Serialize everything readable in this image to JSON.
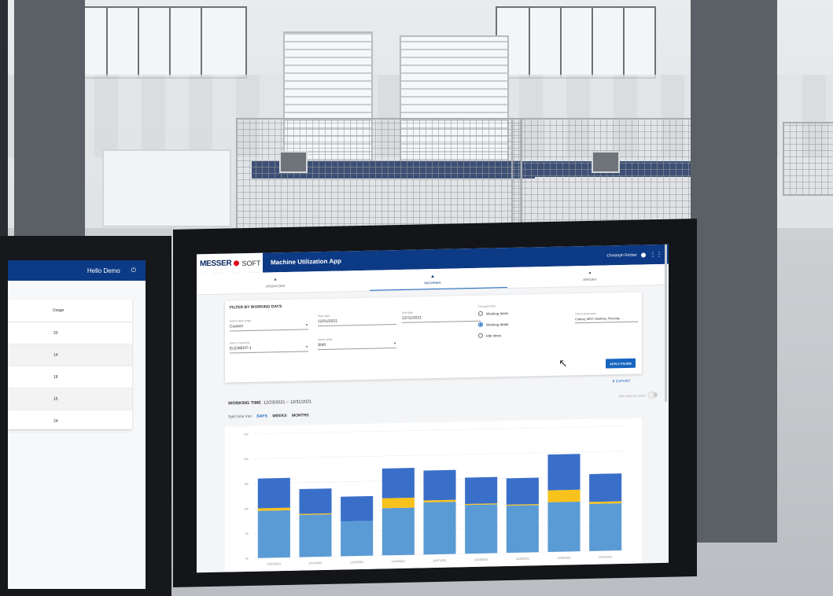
{
  "left_app": {
    "greeting": "Hello Demo",
    "power_icon": "power-icon",
    "table": {
      "header": "Usage",
      "values": [
        "20",
        "14",
        "18",
        "15",
        "24"
      ]
    }
  },
  "app": {
    "logo": {
      "brand": "MESSER",
      "suffix": "SOFT"
    },
    "title": "Machine Utilization App",
    "user": "Christoph Richter",
    "tabs": [
      {
        "label": "OPERATORS",
        "icon": "person-icon"
      },
      {
        "label": "MACHINES",
        "icon": "machine-icon",
        "active": true
      },
      {
        "label": "ERRORS",
        "icon": "error-icon"
      }
    ]
  },
  "filter": {
    "title": "FILTER BY WORKING DAYS",
    "date_range": {
      "label": "Select date range",
      "value": "Custom"
    },
    "start_date": {
      "label": "Start date",
      "value": "12/01/2021"
    },
    "end_date": {
      "label": "End date",
      "value": "12/31/2021"
    },
    "machines": {
      "label": "Select machines",
      "value": "ELEMENT-1"
    },
    "shifts": {
      "label": "Select shifts",
      "value": "Shift"
    },
    "processes": {
      "label": "Select processes",
      "value": "Cutting, MNT, Marking, Piercing..."
    },
    "occupied": {
      "label": "Occupied time",
      "options": [
        {
          "label": "Working times",
          "checked": false
        },
        {
          "label": "Working detail",
          "checked": true
        },
        {
          "label": "Idle times",
          "checked": false
        }
      ]
    },
    "apply_label": "APPLY FILTER"
  },
  "export_label": "EXPORT",
  "working_time": {
    "title": "WORKING TIME",
    "range": "12/23/2021 ~ 12/31/2021",
    "split_label": "Split time into",
    "options": [
      "DAYS",
      "WEEKS",
      "MONTHS"
    ],
    "split_shifts_label": "Split data into shifts"
  },
  "chart_data": {
    "type": "bar",
    "stacked": true,
    "colors": {
      "base": "#5b9bd5",
      "yellow": "#f8c21c",
      "top": "#3a6fc9"
    },
    "categories": [
      "12/23/2021",
      "12/24/2021",
      "12/25/2021",
      "12/26/2021",
      "12/27/2021",
      "12/28/2021",
      "12/29/2021",
      "12/30/2021",
      "12/31/2021"
    ],
    "series": [
      {
        "values": [
          9.5,
          8.5,
          7,
          9.5,
          10.5,
          9.8,
          9.5,
          10,
          9.5
        ]
      },
      {
        "values": [
          0.5,
          0.2,
          0,
          2,
          0.4,
          0.2,
          0.2,
          2.4,
          0.4
        ]
      },
      {
        "values": [
          6,
          5,
          5,
          6,
          6,
          5.3,
          5.3,
          7.2,
          5.6
        ]
      }
    ],
    "y_ticks": [
      "0h",
      "5h",
      "10h",
      "15h",
      "20h",
      "25h"
    ],
    "ylim": [
      0,
      25
    ]
  }
}
